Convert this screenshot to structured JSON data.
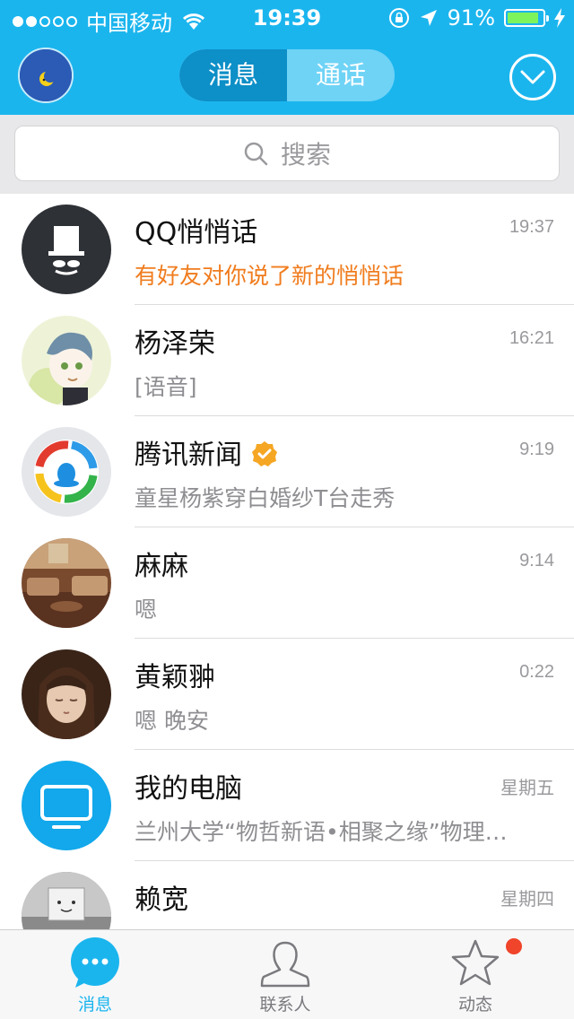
{
  "status_bar": {
    "carrier": "中国移动",
    "time": "19:39",
    "battery": "91%",
    "battery_level": 0.91,
    "signal_bars_filled": 2,
    "signal_bars_total": 5
  },
  "header": {
    "tabs": [
      {
        "label": "消息",
        "active": true
      },
      {
        "label": "通话",
        "active": false
      }
    ]
  },
  "search": {
    "placeholder": "搜索"
  },
  "conversations": [
    {
      "name": "QQ悄悄话",
      "time": "19:37",
      "preview": "有好友对你说了新的悄悄话",
      "verified": false
    },
    {
      "name": "杨泽荣",
      "time": "16:21",
      "preview": "[语音]",
      "verified": false
    },
    {
      "name": "腾讯新闻",
      "time": "9:19",
      "preview": "童星杨紫穿白婚纱T台走秀",
      "verified": true
    },
    {
      "name": "麻麻",
      "time": "9:14",
      "preview": "嗯",
      "verified": false
    },
    {
      "name": "黄颖翀",
      "time": "0:22",
      "preview": "嗯 晚安",
      "verified": false
    },
    {
      "name": "我的电脑",
      "time": "星期五",
      "preview": "兰州大学“物哲新语•相聚之缘”物理…",
      "verified": false
    },
    {
      "name": "赖宽",
      "time": "星期四",
      "preview": "",
      "verified": false
    }
  ],
  "tabbar": {
    "items": [
      {
        "label": "消息",
        "active": true
      },
      {
        "label": "联系人",
        "active": false
      },
      {
        "label": "动态",
        "active": false
      }
    ]
  },
  "colors": {
    "brand": "#1bb5ee",
    "highlight": "#f07c1e",
    "badge": "#f0442b",
    "verified": "#f5a623"
  }
}
